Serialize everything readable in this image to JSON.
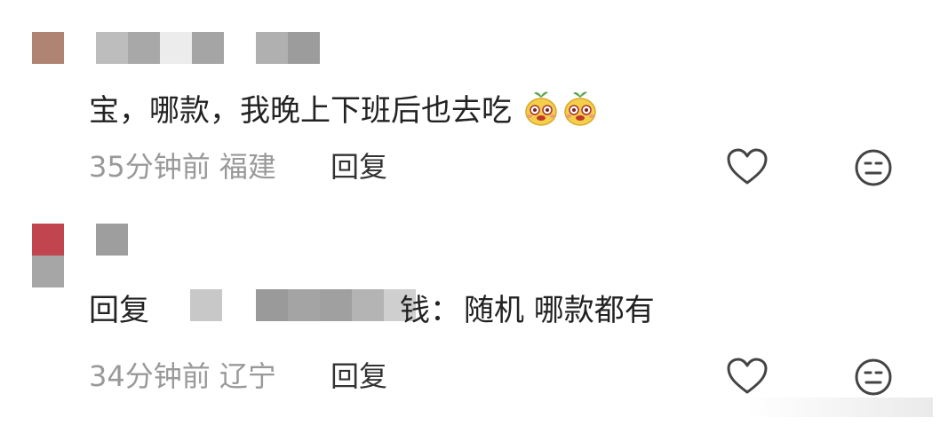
{
  "comments": [
    {
      "text": "宝，哪款，我晚上下班后也去吃",
      "emoji_icons": [
        "sprout-face-emoji",
        "sprout-face-emoji"
      ],
      "time": "35分钟前",
      "location": "福建",
      "reply_label": "回复"
    },
    {
      "reply_prefix": "回复",
      "reply_target_suffix": "钱：",
      "text": "随机 哪款都有",
      "time": "34分钟前",
      "location": "辽宁",
      "reply_label": "回复"
    }
  ],
  "icons": {
    "like": "heart-outline-icon",
    "dislike": "meh-face-icon"
  },
  "colors": {
    "text_primary": "#222222",
    "text_meta": "#999999",
    "icon_stroke": "#444444",
    "avatar1": "#b08472",
    "avatar2_top": "#c1454f",
    "avatar2_bottom": "#a6a6a6"
  }
}
